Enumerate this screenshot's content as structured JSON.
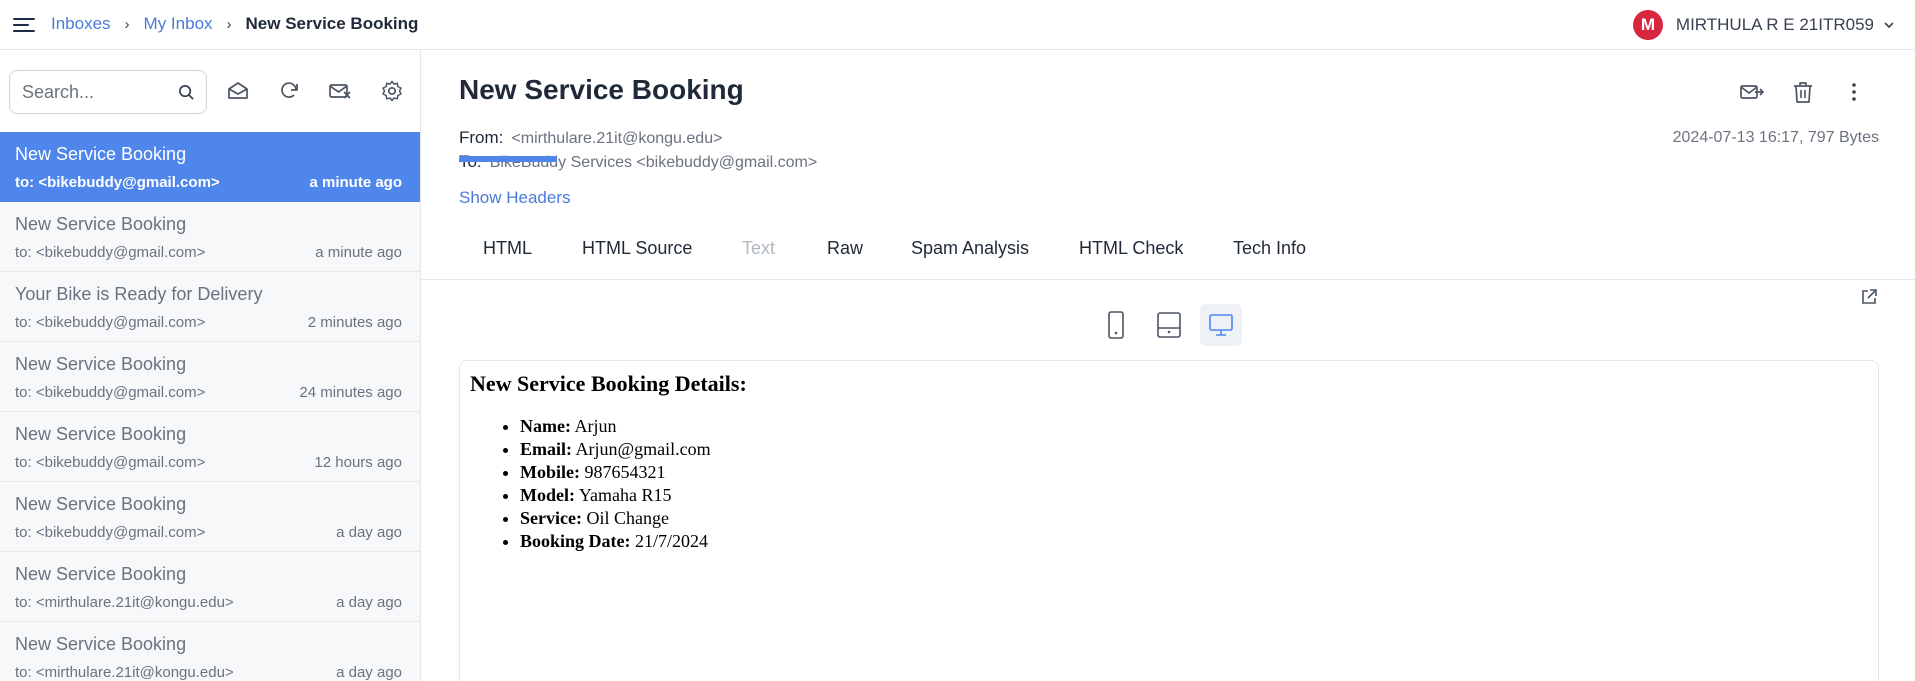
{
  "breadcrumb": {
    "items": [
      "Inboxes",
      "My Inbox"
    ],
    "current": "New Service Booking"
  },
  "user": {
    "initial": "M",
    "name": "MIRTHULA R E 21ITR059",
    "avatar_color": "#d7263d"
  },
  "sidebar": {
    "search_placeholder": "Search...",
    "tool_icons": [
      "mark-read-icon",
      "refresh-icon",
      "clear-inbox-icon",
      "settings-icon"
    ],
    "messages": [
      {
        "subject": "New Service Booking",
        "to": "to: <bikebuddy@gmail.com>",
        "time": "a minute ago",
        "active": true
      },
      {
        "subject": "New Service Booking",
        "to": "to: <bikebuddy@gmail.com>",
        "time": "a minute ago"
      },
      {
        "subject": "Your Bike is Ready for Delivery",
        "to": "to: <bikebuddy@gmail.com>",
        "time": "2 minutes ago"
      },
      {
        "subject": "New Service Booking",
        "to": "to: <bikebuddy@gmail.com>",
        "time": "24 minutes ago"
      },
      {
        "subject": "New Service Booking",
        "to": "to: <bikebuddy@gmail.com>",
        "time": "12 hours ago"
      },
      {
        "subject": "New Service Booking",
        "to": "to: <bikebuddy@gmail.com>",
        "time": "a day ago"
      },
      {
        "subject": "New Service Booking",
        "to": "to: <mirthulare.21it@kongu.edu>",
        "time": "a day ago"
      },
      {
        "subject": "New Service Booking",
        "to": "to: <mirthulare.21it@kongu.edu>",
        "time": "a day ago"
      }
    ]
  },
  "mail": {
    "title": "New Service Booking",
    "from_label": "From:",
    "from_value": "<mirthulare.21it@kongu.edu>",
    "to_label": "To:",
    "to_value": "BikeBuddy Services <bikebuddy@gmail.com>",
    "date_size": "2024-07-13 16:17, 797 Bytes",
    "show_headers": "Show Headers",
    "actions": [
      "forward-icon",
      "delete-icon",
      "more-icon"
    ]
  },
  "tabs": [
    {
      "label": "HTML",
      "active": true
    },
    {
      "label": "HTML Source"
    },
    {
      "label": "Text",
      "disabled": true
    },
    {
      "label": "Raw"
    },
    {
      "label": "Spam Analysis"
    },
    {
      "label": "HTML Check"
    },
    {
      "label": "Tech Info"
    }
  ],
  "preview_devices": {
    "options": [
      "mobile",
      "tablet",
      "desktop"
    ],
    "selected": "desktop"
  },
  "body": {
    "heading": "New Service Booking Details:",
    "fields": [
      {
        "label": "Name:",
        "value": "Arjun"
      },
      {
        "label": "Email:",
        "value": "Arjun@gmail.com"
      },
      {
        "label": "Mobile:",
        "value": "987654321"
      },
      {
        "label": "Model:",
        "value": "Yamaha R15"
      },
      {
        "label": "Service:",
        "value": "Oil Change"
      },
      {
        "label": "Booking Date:",
        "value": "21/7/2024"
      }
    ]
  },
  "colors": {
    "accent": "#4f86ec",
    "link": "#4a7bd8"
  }
}
